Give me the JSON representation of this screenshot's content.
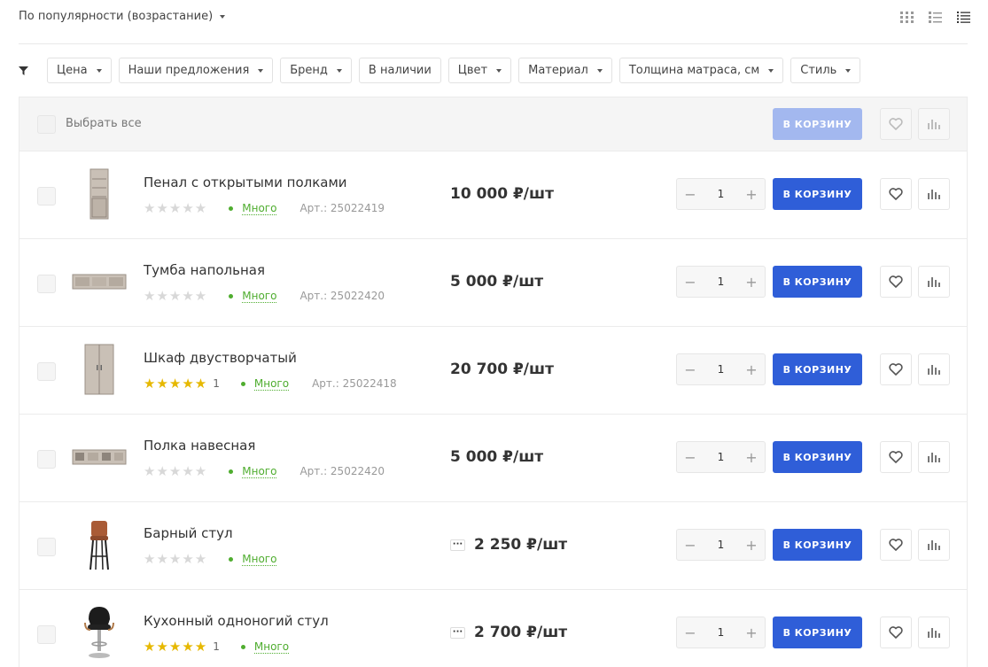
{
  "sort": {
    "label": "По популярности (возрастание)"
  },
  "views": [
    "tile-view-icon",
    "list-view-icon",
    "table-view-icon"
  ],
  "filters": [
    {
      "label": "Цена",
      "dropdown": true
    },
    {
      "label": "Наши предложения",
      "dropdown": true
    },
    {
      "label": "Бренд",
      "dropdown": true
    },
    {
      "label": "В наличии",
      "dropdown": false
    },
    {
      "label": "Цвет",
      "dropdown": true
    },
    {
      "label": "Материал",
      "dropdown": true
    },
    {
      "label": "Толщина матраса, см",
      "dropdown": true
    },
    {
      "label": "Стиль",
      "dropdown": true
    }
  ],
  "header": {
    "select_all": "Выбрать все",
    "cart_label": "В КОРЗИНУ"
  },
  "products": [
    {
      "name": "Пенал с открытыми полками",
      "rating": 0,
      "reviews": "",
      "stock": "Много",
      "article": "Арт.: 25022419",
      "price": "10 000 ₽/шт",
      "more": false,
      "qty": "1",
      "cart_label": "В КОРЗИНУ",
      "image": "tall-cabinet"
    },
    {
      "name": "Тумба напольная",
      "rating": 0,
      "reviews": "",
      "stock": "Много",
      "article": "Арт.: 25022420",
      "price": "5 000 ₽/шт",
      "more": false,
      "qty": "1",
      "cart_label": "В КОРЗИНУ",
      "image": "tv-stand"
    },
    {
      "name": "Шкаф двустворчатый",
      "rating": 5,
      "reviews": "1",
      "stock": "Много",
      "article": "Арт.: 25022418",
      "price": "20 700 ₽/шт",
      "more": false,
      "qty": "1",
      "cart_label": "В КОРЗИНУ",
      "image": "wardrobe"
    },
    {
      "name": "Полка навесная",
      "rating": 0,
      "reviews": "",
      "stock": "Много",
      "article": "Арт.: 25022420",
      "price": "5 000 ₽/шт",
      "more": false,
      "qty": "1",
      "cart_label": "В КОРЗИНУ",
      "image": "wall-shelf"
    },
    {
      "name": "Барный стул",
      "rating": 0,
      "reviews": "",
      "stock": "Много",
      "article": "",
      "price": "2 250 ₽/шт",
      "more": true,
      "qty": "1",
      "cart_label": "В КОРЗИНУ",
      "image": "bar-stool"
    },
    {
      "name": "Кухонный одноногий стул",
      "rating": 5,
      "reviews": "1",
      "stock": "Много",
      "article": "",
      "price": "2 700 ₽/шт",
      "more": true,
      "qty": "1",
      "cart_label": "В КОРЗИНУ",
      "image": "kitchen-stool"
    }
  ],
  "colors": {
    "accent": "#2f5ed8",
    "accent_disabled": "#a3b8ef",
    "stock": "#4fad2f",
    "star": "#e6b800"
  }
}
